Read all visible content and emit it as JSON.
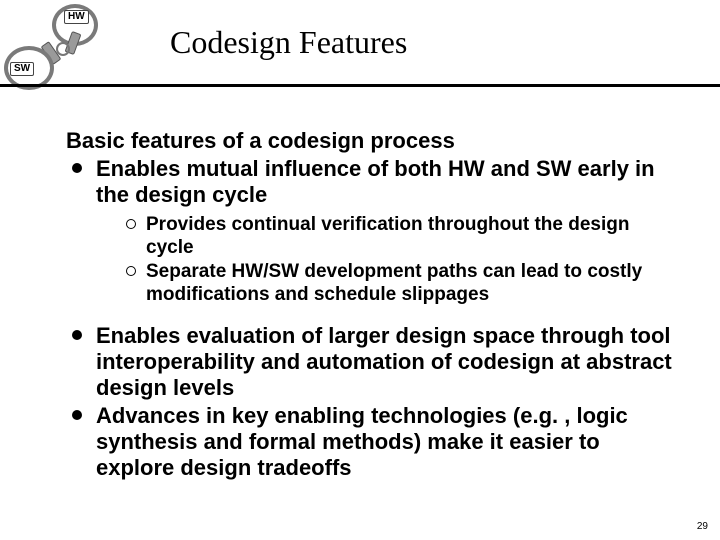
{
  "logo": {
    "tag1": "HW",
    "tag2": "SW"
  },
  "title": "Codesign Features",
  "lead": "Basic features of a codesign process",
  "bullets": {
    "b1": "Enables mutual influence of both HW and SW early in the design cycle",
    "b1a": "Provides continual verification throughout the design cycle",
    "b1b": "Separate HW/SW development paths can lead to costly modifications and schedule slippages",
    "b2": "Enables evaluation of larger design space through tool interoperability and automation of codesign at abstract design levels",
    "b3": "Advances in key enabling technologies (e.g. , logic synthesis and formal methods) make it easier to explore design tradeoffs"
  },
  "page": "29"
}
